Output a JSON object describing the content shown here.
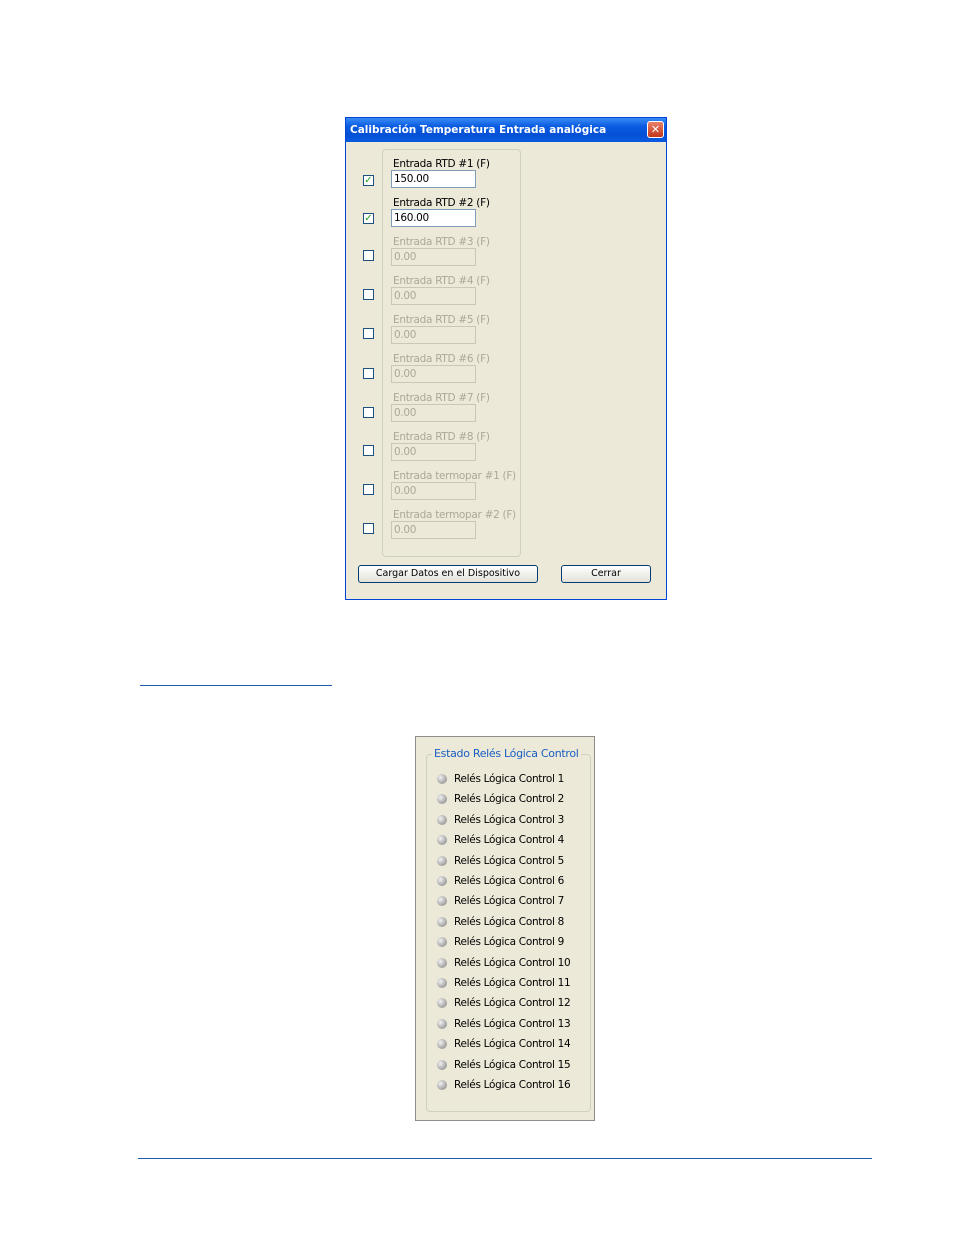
{
  "dialog": {
    "title": "Calibración Temperatura Entrada analógica",
    "close_symbol": "✕",
    "inputs": [
      {
        "label": "Entrada RTD #1 (F)",
        "value": "150.00",
        "checked": true,
        "enabled": true
      },
      {
        "label": "Entrada RTD #2 (F)",
        "value": "160.00",
        "checked": true,
        "enabled": true
      },
      {
        "label": "Entrada RTD #3 (F)",
        "value": "0.00",
        "checked": false,
        "enabled": false
      },
      {
        "label": "Entrada RTD #4 (F)",
        "value": "0.00",
        "checked": false,
        "enabled": false
      },
      {
        "label": "Entrada RTD #5 (F)",
        "value": "0.00",
        "checked": false,
        "enabled": false
      },
      {
        "label": "Entrada RTD #6 (F)",
        "value": "0.00",
        "checked": false,
        "enabled": false
      },
      {
        "label": "Entrada RTD #7 (F)",
        "value": "0.00",
        "checked": false,
        "enabled": false
      },
      {
        "label": "Entrada RTD #8 (F)",
        "value": "0.00",
        "checked": false,
        "enabled": false
      },
      {
        "label": "Entrada termopar #1 (F)",
        "value": "0.00",
        "checked": false,
        "enabled": false
      },
      {
        "label": "Entrada termopar #2 (F)",
        "value": "0.00",
        "checked": false,
        "enabled": false
      }
    ],
    "load_button": "Cargar Datos en el Dispositivo",
    "close_button": "Cerrar"
  },
  "relay_panel": {
    "legend": "Estado Relés Lógica Control",
    "relays": [
      "Relés Lógica Control 1",
      "Relés Lógica Control 2",
      "Relés Lógica Control 3",
      "Relés Lógica Control 4",
      "Relés Lógica Control 5",
      "Relés Lógica Control 6",
      "Relés Lógica Control 7",
      "Relés Lógica Control 8",
      "Relés Lógica Control 9",
      "Relés Lógica Control 10",
      "Relés Lógica Control 11",
      "Relés Lógica Control 12",
      "Relés Lógica Control 13",
      "Relés Lógica Control 14",
      "Relés Lógica Control 15",
      "Relés Lógica Control 16"
    ]
  }
}
